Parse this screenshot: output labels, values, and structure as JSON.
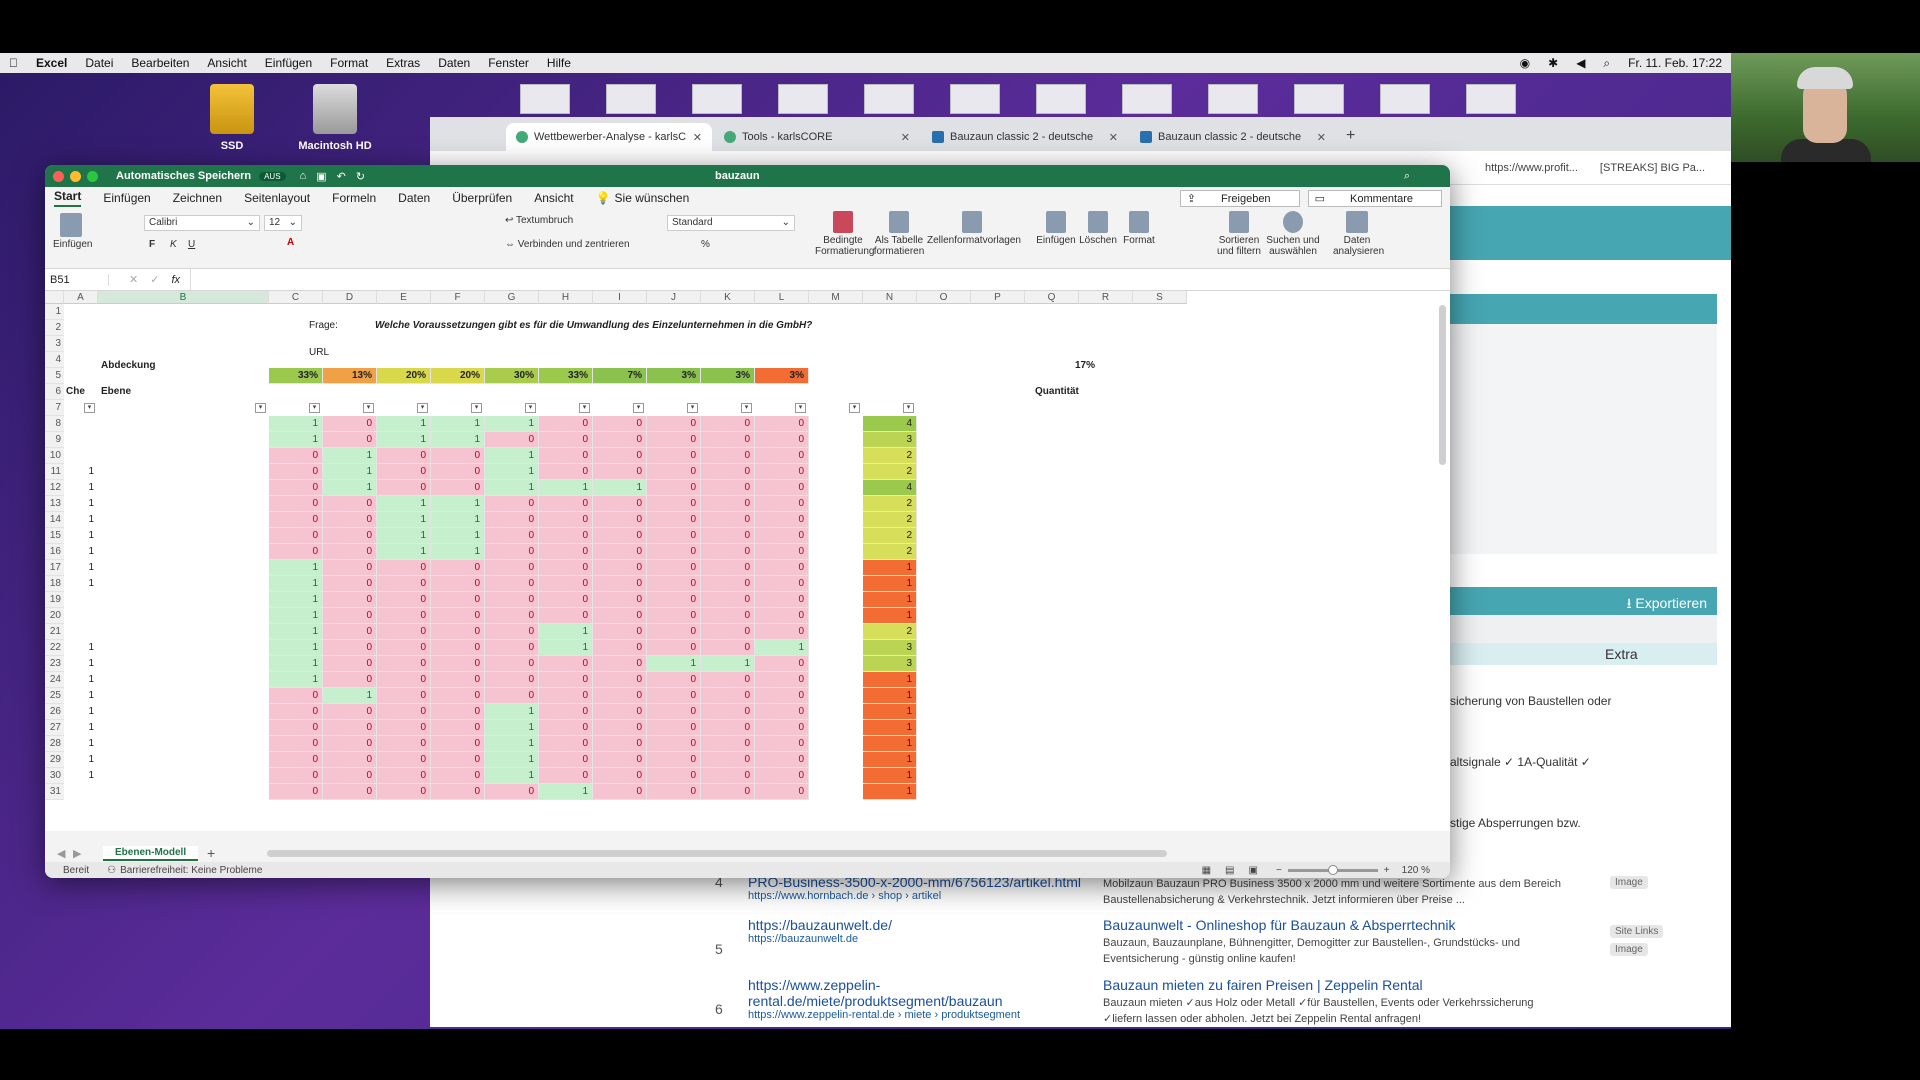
{
  "menubar": {
    "items": [
      "Excel",
      "Datei",
      "Bearbeiten",
      "Ansicht",
      "Einfügen",
      "Format",
      "Extras",
      "Daten",
      "Fenster",
      "Hilfe"
    ],
    "clock": "Fr. 11. Feb.  17:22"
  },
  "desktop": {
    "icons": [
      "SSD",
      "Macintosh HD"
    ]
  },
  "browser": {
    "tabs": [
      {
        "title": "Wettbewerber-Analyse - karlsC"
      },
      {
        "title": "Tools - karlsCORE"
      },
      {
        "title": "Bauzaun classic 2 - deutsche"
      },
      {
        "title": "Bauzaun classic 2 - deutsche"
      }
    ],
    "bookmarks": [
      "https://www.profit...",
      "[STREAKS] BIG Pa..."
    ],
    "export_label": "Exportieren",
    "extra_label": "Extra",
    "snippets": [
      "sicherung von Baustellen oder",
      "altsignale ✓ 1A-Qualität ✓",
      "stige Absperrungen bzw."
    ],
    "results": [
      {
        "num": "4",
        "link": "PRO-Business-3500-x-2000-mm/6756123/artikel.html",
        "url": "https://www.hornbach.de › shop › artikel",
        "title": "",
        "desc": "Mobilzaun Bauzaun PRO Business 3500 x 2000 mm und weitere Sortimente aus dem Bereich Baustellenabsicherung & Verkehrstechnik. Jetzt informieren über Preise ...",
        "badges": [
          "Image"
        ]
      },
      {
        "num": "5",
        "link": "https://bauzaunwelt.de/",
        "url": "https://bauzaunwelt.de",
        "title": "Bauzaunwelt - Onlineshop für Bauzaun & Absperrtechnik",
        "desc": "Bauzaun, Bauzaunplane, Bühnengitter, Demogitter zur Baustellen-, Grundstücks- und Eventsicherung - günstig online kaufen!",
        "badges": [
          "Site Links",
          "Image"
        ]
      },
      {
        "num": "6",
        "link": "https://www.zeppelin-rental.de/miete/produktsegment/bauzaun",
        "url": "https://www.zeppelin-rental.de › miete › produktsegment",
        "title": "Bauzaun mieten zu fairen Preisen | Zeppelin Rental",
        "desc": "Bauzaun mieten ✓aus Holz oder Metall ✓für Baustellen, Events oder Verkehrssicherung ✓liefern lassen oder abholen. Jetzt bei Zeppelin Rental anfragen!",
        "badges": []
      }
    ]
  },
  "excel": {
    "autosave": "Automatisches Speichern",
    "autosave_state": "AUS",
    "doc_title": "bauzaun",
    "ribbon_tabs": [
      "Start",
      "Einfügen",
      "Zeichnen",
      "Seitenlayout",
      "Formeln",
      "Daten",
      "Überprüfen",
      "Ansicht"
    ],
    "tell_me": "Sie wünschen",
    "share": "Freigeben",
    "comments": "Kommentare",
    "font_name": "Calibri",
    "font_size": "12",
    "number_format": "Standard",
    "wrap_text": "Textumbruch",
    "merge": "Verbinden und zentrieren",
    "paste": "Einfügen",
    "buttons": [
      "Bedingte Formatierung",
      "Als Tabelle formatieren",
      "Zellenformatvorlagen",
      "Einfügen",
      "Löschen",
      "Format",
      "Sortieren und filtern",
      "Suchen und auswählen",
      "Daten analysieren"
    ],
    "name_box": "B51",
    "fx": "fx",
    "columns": [
      "A",
      "B",
      "C",
      "D",
      "E",
      "F",
      "G",
      "H",
      "I",
      "J",
      "K",
      "L",
      "M",
      "N",
      "O",
      "P",
      "Q",
      "R",
      "S"
    ],
    "frage_label": "Frage:",
    "frage_text": "Welche Voraussetzungen gibt es für die Umwandlung des Einzelunternehmen in die GmbH?",
    "url_label": "URL",
    "abdeckung_label": "Abdeckung",
    "abdeckung": [
      "33%",
      "13%",
      "20%",
      "20%",
      "30%",
      "33%",
      "7%",
      "3%",
      "3%",
      "3%"
    ],
    "abdeckung_total": "17%",
    "abdeckung_colors": [
      "#9bc94d",
      "#f0a045",
      "#d8d84a",
      "#d8d84a",
      "#a9cc4d",
      "#9bc94d",
      "#8ac24d",
      "#8ac24d",
      "#8ac24d",
      "#f26c33"
    ],
    "header_che": "Che",
    "header_ebene": "Ebene",
    "header_quant": "Quantität",
    "rows": [
      {
        "n": "8",
        "a": "",
        "v": [
          1,
          0,
          1,
          1,
          1,
          0,
          0,
          0,
          0,
          0
        ],
        "q": "4"
      },
      {
        "n": "9",
        "a": "",
        "v": [
          1,
          0,
          1,
          1,
          0,
          0,
          0,
          0,
          0,
          0
        ],
        "q": "3"
      },
      {
        "n": "10",
        "a": "",
        "v": [
          0,
          1,
          0,
          0,
          1,
          0,
          0,
          0,
          0,
          0
        ],
        "q": "2"
      },
      {
        "n": "11",
        "a": "1",
        "v": [
          0,
          1,
          0,
          0,
          1,
          0,
          0,
          0,
          0,
          0
        ],
        "q": "2"
      },
      {
        "n": "12",
        "a": "1",
        "v": [
          0,
          1,
          0,
          0,
          1,
          1,
          1,
          0,
          0,
          0
        ],
        "q": "4"
      },
      {
        "n": "13",
        "a": "1",
        "v": [
          0,
          0,
          1,
          1,
          0,
          0,
          0,
          0,
          0,
          0
        ],
        "q": "2"
      },
      {
        "n": "14",
        "a": "1",
        "v": [
          0,
          0,
          1,
          1,
          0,
          0,
          0,
          0,
          0,
          0
        ],
        "q": "2"
      },
      {
        "n": "15",
        "a": "1",
        "v": [
          0,
          0,
          1,
          1,
          0,
          0,
          0,
          0,
          0,
          0
        ],
        "q": "2"
      },
      {
        "n": "16",
        "a": "1",
        "v": [
          0,
          0,
          1,
          1,
          0,
          0,
          0,
          0,
          0,
          0
        ],
        "q": "2"
      },
      {
        "n": "17",
        "a": "1",
        "v": [
          1,
          0,
          0,
          0,
          0,
          0,
          0,
          0,
          0,
          0
        ],
        "q": "1"
      },
      {
        "n": "18",
        "a": "1",
        "v": [
          1,
          0,
          0,
          0,
          0,
          0,
          0,
          0,
          0,
          0
        ],
        "q": "1"
      },
      {
        "n": "19",
        "a": "",
        "v": [
          1,
          0,
          0,
          0,
          0,
          0,
          0,
          0,
          0,
          0
        ],
        "q": "1"
      },
      {
        "n": "20",
        "a": "",
        "v": [
          1,
          0,
          0,
          0,
          0,
          0,
          0,
          0,
          0,
          0
        ],
        "q": "1"
      },
      {
        "n": "21",
        "a": "",
        "v": [
          1,
          0,
          0,
          0,
          0,
          1,
          0,
          0,
          0,
          0
        ],
        "q": "2"
      },
      {
        "n": "22",
        "a": "1",
        "v": [
          1,
          0,
          0,
          0,
          0,
          1,
          0,
          0,
          0,
          1
        ],
        "q": "3"
      },
      {
        "n": "23",
        "a": "1",
        "v": [
          1,
          0,
          0,
          0,
          0,
          0,
          0,
          1,
          1,
          0
        ],
        "q": "3"
      },
      {
        "n": "24",
        "a": "1",
        "v": [
          1,
          0,
          0,
          0,
          0,
          0,
          0,
          0,
          0,
          0
        ],
        "q": "1"
      },
      {
        "n": "25",
        "a": "1",
        "v": [
          0,
          1,
          0,
          0,
          0,
          0,
          0,
          0,
          0,
          0
        ],
        "q": "1"
      },
      {
        "n": "26",
        "a": "1",
        "v": [
          0,
          0,
          0,
          0,
          1,
          0,
          0,
          0,
          0,
          0
        ],
        "q": "1"
      },
      {
        "n": "27",
        "a": "1",
        "v": [
          0,
          0,
          0,
          0,
          1,
          0,
          0,
          0,
          0,
          0
        ],
        "q": "1"
      },
      {
        "n": "28",
        "a": "1",
        "v": [
          0,
          0,
          0,
          0,
          1,
          0,
          0,
          0,
          0,
          0
        ],
        "q": "1"
      },
      {
        "n": "29",
        "a": "1",
        "v": [
          0,
          0,
          0,
          0,
          1,
          0,
          0,
          0,
          0,
          0
        ],
        "q": "1"
      },
      {
        "n": "30",
        "a": "1",
        "v": [
          0,
          0,
          0,
          0,
          1,
          0,
          0,
          0,
          0,
          0
        ],
        "q": "1"
      },
      {
        "n": "31",
        "a": "",
        "v": [
          0,
          0,
          0,
          0,
          0,
          1,
          0,
          0,
          0,
          0
        ],
        "q": "1"
      }
    ],
    "quant_colors": {
      "1": "#f26c33",
      "2": "#d7df5a",
      "3": "#bcd453",
      "4": "#9bc94d"
    },
    "sheet_tab": "Ebenen-Modell",
    "status_ready": "Bereit",
    "status_access": "Barrierefreiheit: Keine Probleme",
    "zoom": "120 %"
  }
}
